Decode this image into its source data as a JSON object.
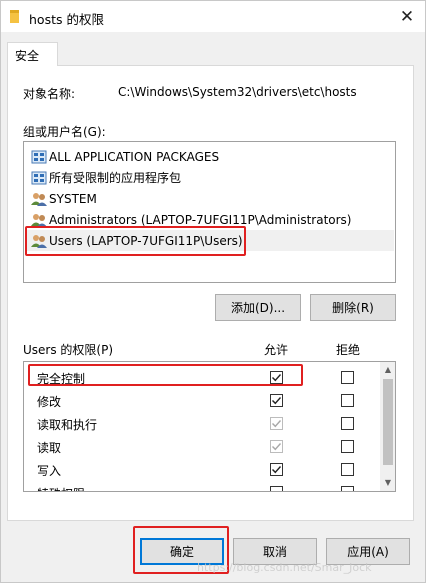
{
  "window": {
    "title": "hosts 的权限",
    "close_glyph": "✕"
  },
  "tab": {
    "label": "安全"
  },
  "object": {
    "label": "对象名称:",
    "value": "C:\\Windows\\System32\\drivers\\etc\\hosts"
  },
  "groups": {
    "label": "组或用户名(G):",
    "items": [
      {
        "name": "ALL APPLICATION PACKAGES",
        "icon": "package-group-icon"
      },
      {
        "name": "所有受限制的应用程序包",
        "icon": "package-group-icon"
      },
      {
        "name": "SYSTEM",
        "icon": "users-group-icon"
      },
      {
        "name": "Administrators (LAPTOP-7UFGI11P\\Administrators)",
        "icon": "users-group-icon"
      },
      {
        "name": "Users (LAPTOP-7UFGI11P\\Users)",
        "icon": "users-group-icon",
        "selected": true
      }
    ]
  },
  "buttons": {
    "add": "添加(D)...",
    "remove": "删除(R)",
    "ok": "确定",
    "cancel": "取消",
    "apply": "应用(A)"
  },
  "permissions": {
    "title": "Users 的权限(P)",
    "allow_header": "允许",
    "deny_header": "拒绝",
    "rows": [
      {
        "label": "完全控制",
        "allow": true,
        "allow_disabled": false,
        "deny": false
      },
      {
        "label": "修改",
        "allow": true,
        "allow_disabled": false,
        "deny": false
      },
      {
        "label": "读取和执行",
        "allow": true,
        "allow_disabled": true,
        "deny": false
      },
      {
        "label": "读取",
        "allow": true,
        "allow_disabled": true,
        "deny": false
      },
      {
        "label": "写入",
        "allow": true,
        "allow_disabled": false,
        "deny": false
      },
      {
        "label": "特殊权限",
        "allow": false,
        "allow_disabled": false,
        "deny": false
      }
    ]
  },
  "highlight_color": "#e02020",
  "watermark": "https://blog.csdn.net/Smar_Jock"
}
